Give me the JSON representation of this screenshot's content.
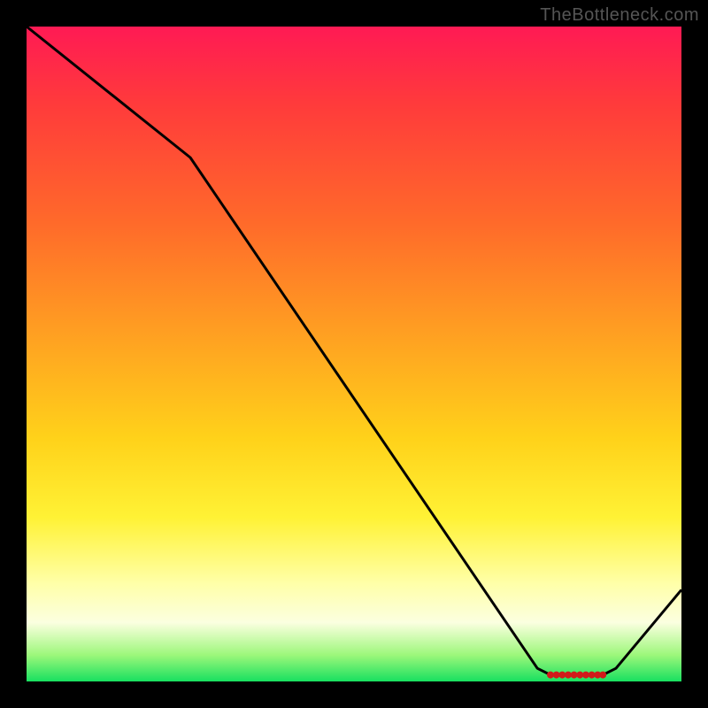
{
  "attribution": "TheBottleneck.com",
  "chart_data": {
    "type": "line",
    "title": "",
    "xlabel": "",
    "ylabel": "",
    "xlim": [
      0,
      100
    ],
    "ylim": [
      0,
      100
    ],
    "grid": false,
    "legend": false,
    "series": [
      {
        "name": "bottleneck-curve",
        "x": [
          0,
          25,
          78,
          80,
          88,
          90,
          100
        ],
        "values": [
          100,
          80,
          2,
          1,
          1,
          2,
          14
        ]
      }
    ],
    "markers": {
      "name": "optimal-range-dots",
      "x": [
        80.0,
        80.9,
        81.8,
        82.7,
        83.6,
        84.5,
        85.4,
        86.3,
        87.2,
        88.0
      ],
      "values": [
        1.0,
        1.0,
        1.0,
        1.0,
        1.0,
        1.0,
        1.0,
        1.0,
        1.0,
        1.0
      ]
    }
  },
  "colors": {
    "curve": "#000000",
    "markers": "#d11a1a"
  }
}
